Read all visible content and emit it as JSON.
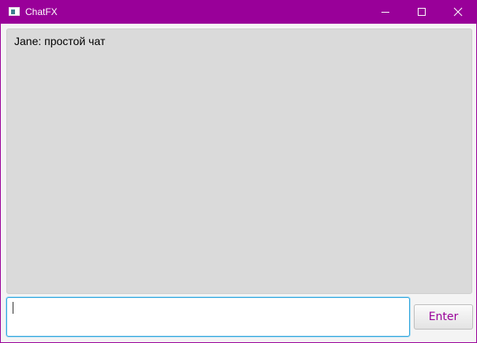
{
  "window": {
    "title": "ChatFX",
    "accent_color": "#990099",
    "controls": {
      "minimize_icon": "minimize-icon",
      "maximize_icon": "maximize-icon",
      "close_icon": "close-icon"
    }
  },
  "chat": {
    "messages": [
      {
        "text": "Jane: простой чат"
      }
    ]
  },
  "input": {
    "value": "",
    "placeholder": ""
  },
  "enter_button": {
    "label": "Enter",
    "color": "#990099"
  }
}
